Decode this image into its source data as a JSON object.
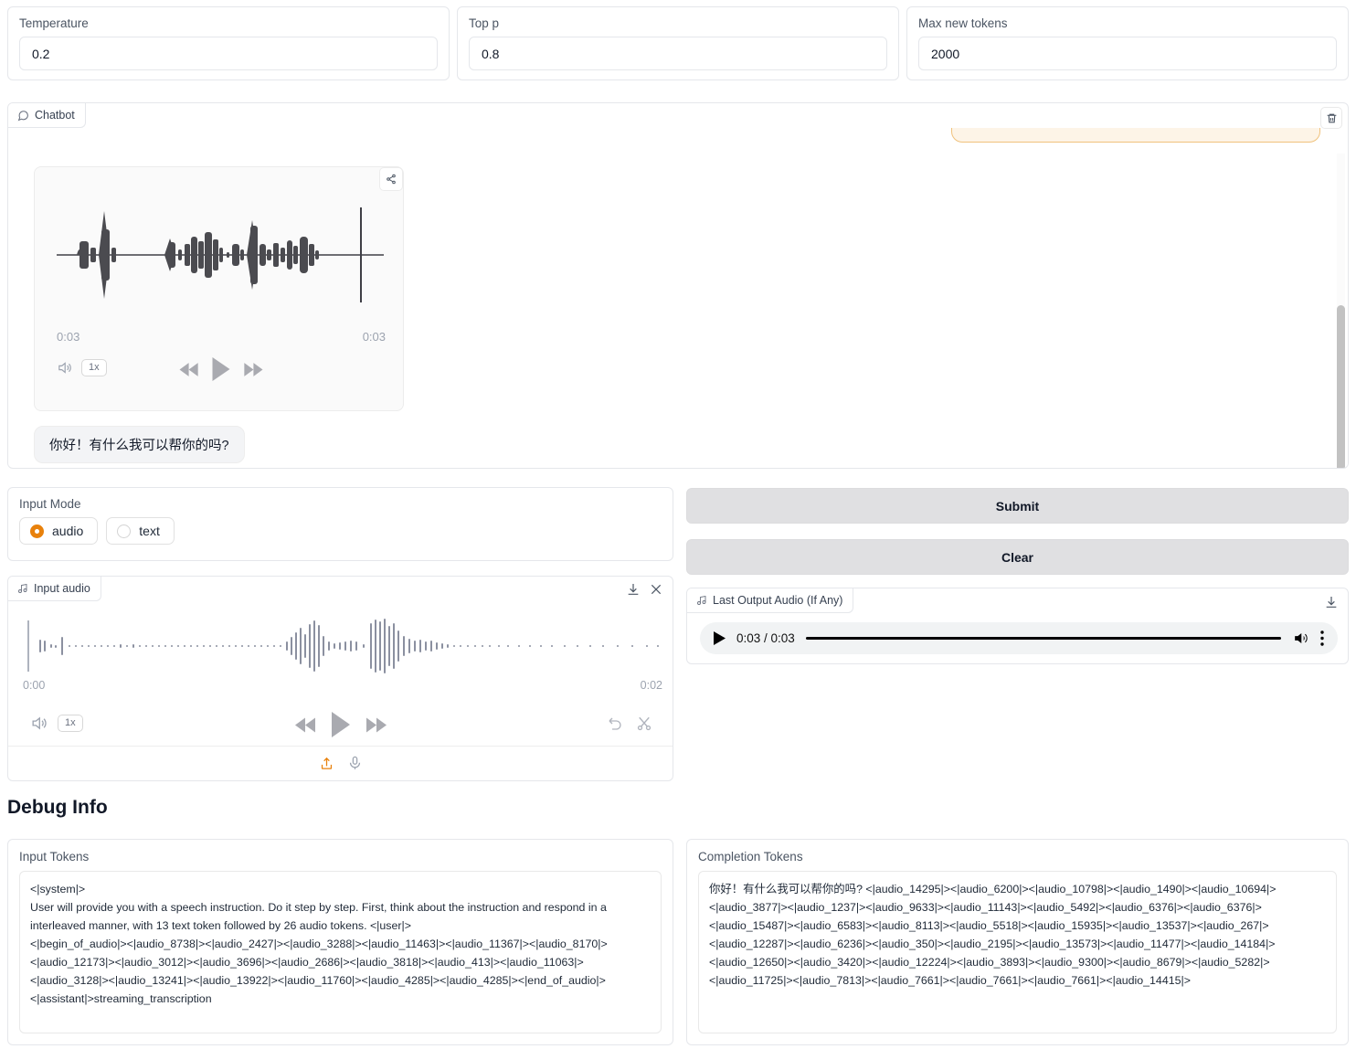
{
  "params": {
    "temperature": {
      "label": "Temperature",
      "value": "0.2"
    },
    "top_p": {
      "label": "Top p",
      "value": "0.8"
    },
    "max_new_tokens": {
      "label": "Max new tokens",
      "value": "2000"
    }
  },
  "chatbot": {
    "tab_label": "Chatbot",
    "audio_message": {
      "current_time": "0:03",
      "total_time": "0:03",
      "speed": "1x"
    },
    "text_message": "你好！有什么我可以帮你的吗?"
  },
  "input_mode": {
    "label": "Input Mode",
    "options": [
      {
        "label": "audio",
        "selected": true
      },
      {
        "label": "text",
        "selected": false
      }
    ]
  },
  "input_audio": {
    "tab_label": "Input audio",
    "start_time": "0:00",
    "end_time": "0:02",
    "speed": "1x"
  },
  "actions": {
    "submit_label": "Submit",
    "clear_label": "Clear"
  },
  "output_audio": {
    "tab_label": "Last Output Audio (If Any)",
    "time_display": "0:03 / 0:03"
  },
  "debug": {
    "heading": "Debug Info",
    "input_tokens": {
      "label": "Input Tokens",
      "value": "<|system|>\nUser will provide you with a speech instruction. Do it step by step. First, think about the instruction and respond in a interleaved manner, with 13 text token followed by 26 audio tokens. <|user|>\n<|begin_of_audio|><|audio_8738|><|audio_2427|><|audio_3288|><|audio_11463|><|audio_11367|><|audio_8170|>\n<|audio_12173|><|audio_3012|><|audio_3696|><|audio_2686|><|audio_3818|><|audio_413|><|audio_11063|>\n<|audio_3128|><|audio_13241|><|audio_13922|><|audio_11760|><|audio_4285|><|audio_4285|><|end_of_audio|>\n<|assistant|>streaming_transcription"
    },
    "completion_tokens": {
      "label": "Completion Tokens",
      "value": "你好！有什么我可以帮你的吗? <|audio_14295|><|audio_6200|><|audio_10798|><|audio_1490|><|audio_10694|>\n<|audio_3877|><|audio_1237|><|audio_9633|><|audio_11143|><|audio_5492|><|audio_6376|><|audio_6376|>\n<|audio_15487|><|audio_6583|><|audio_8113|><|audio_5518|><|audio_15935|><|audio_13537|><|audio_267|>\n<|audio_12287|><|audio_6236|><|audio_350|><|audio_2195|><|audio_13573|><|audio_11477|><|audio_14184|>\n<|audio_12650|><|audio_3420|><|audio_12224|><|audio_3893|><|audio_9300|><|audio_8679|><|audio_5282|>\n<|audio_11725|><|audio_7813|><|audio_7661|><|audio_7661|><|audio_7661|><|audio_14415|>"
    }
  },
  "colors": {
    "accent": "#e8810c",
    "pending_bg": "#fdf4e7",
    "pending_border": "#f0c27d",
    "button_bg": "#e0e0e2"
  }
}
